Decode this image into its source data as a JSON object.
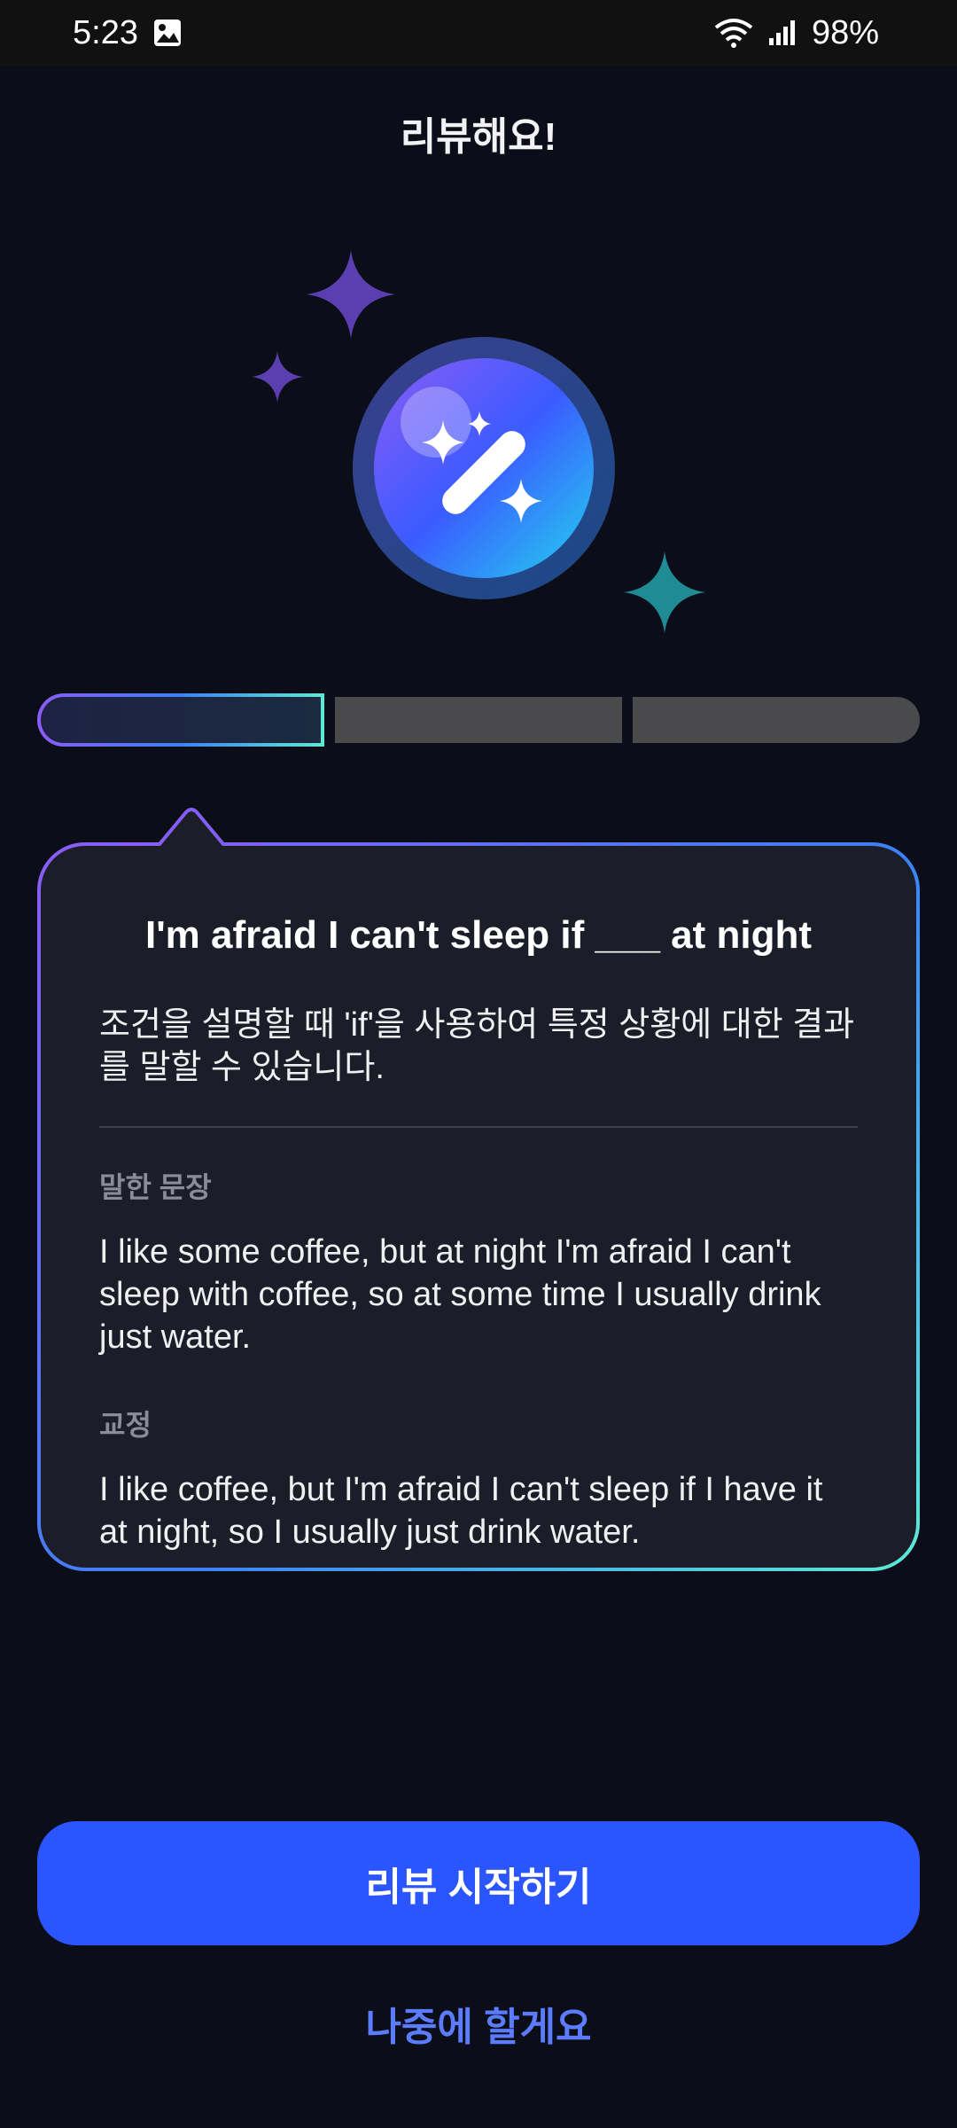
{
  "status_bar": {
    "time": "5:23",
    "battery": "98%",
    "icons": [
      "gallery-icon",
      "wifi-icon",
      "signal-icon"
    ]
  },
  "header": {
    "title": "리뷰해요!"
  },
  "hero": {
    "icon": "magic-wand-icon",
    "decor": [
      "sparkle-icon"
    ]
  },
  "progress": {
    "total_steps": 3,
    "current_step": 1
  },
  "card": {
    "title": "I'm afraid I can't sleep if ___ at night",
    "description": "조건을 설명할 때 'if'을 사용하여 특정 상황에 대한 결과를 말할 수 있습니다.",
    "spoken_label": "말한 문장",
    "spoken_text": "I like some coffee, but at night I'm afraid I can't sleep with coffee, so at some time I usually drink just water.",
    "correction_label": "교정",
    "correction_text": "I like coffee, but I'm afraid I can't sleep if I have it at night, so I usually just drink water."
  },
  "actions": {
    "primary_label": "리뷰 시작하기",
    "secondary_label": "나중에 할게요"
  },
  "colors": {
    "background": "#0b0e19",
    "card": "#1b1e29",
    "primary": "#2a55ff",
    "link": "#5b7cff",
    "sparkle_purple": "#5b3fb0",
    "sparkle_teal": "#1f8c95"
  }
}
